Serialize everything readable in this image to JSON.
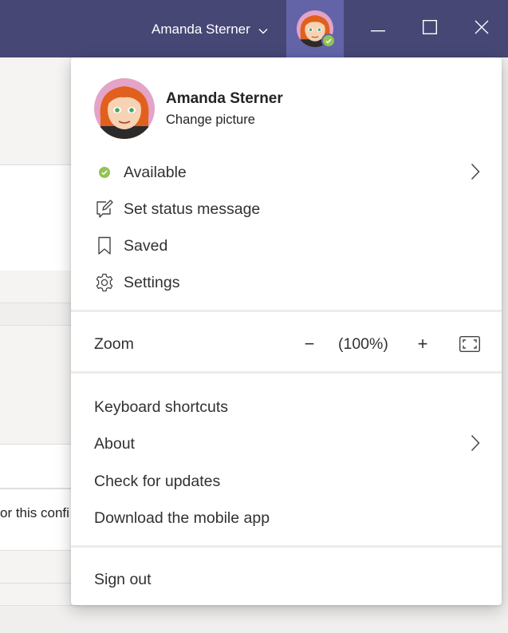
{
  "titlebar": {
    "user_name": "Amanda Sterner",
    "chevron_icon": "chevron-down-icon",
    "window_controls": {
      "minimize_icon": "minimize-icon",
      "maximize_icon": "maximize-icon",
      "close_icon": "close-icon"
    }
  },
  "background": {
    "partial_text": "or this confi"
  },
  "profile": {
    "name": "Amanda Sterner",
    "change_picture": "Change picture"
  },
  "menu": {
    "status": {
      "label": "Available",
      "icon": "available-status-icon"
    },
    "status_message": {
      "label": "Set status message",
      "icon": "edit-note-icon"
    },
    "saved": {
      "label": "Saved",
      "icon": "bookmark-icon"
    },
    "settings": {
      "label": "Settings",
      "icon": "gear-icon"
    }
  },
  "zoom": {
    "label": "Zoom",
    "decrease": "−",
    "value": "(100%)",
    "increase": "+",
    "fullscreen_icon": "fullscreen-icon"
  },
  "info": {
    "keyboard_shortcuts": "Keyboard shortcuts",
    "about": "About",
    "check_updates": "Check for updates",
    "download_app": "Download the mobile app"
  },
  "sign_out": "Sign out",
  "colors": {
    "titlebar": "#464775",
    "avatar_highlight": "#6264a7",
    "available_green": "#92c353",
    "text": "#323130"
  }
}
